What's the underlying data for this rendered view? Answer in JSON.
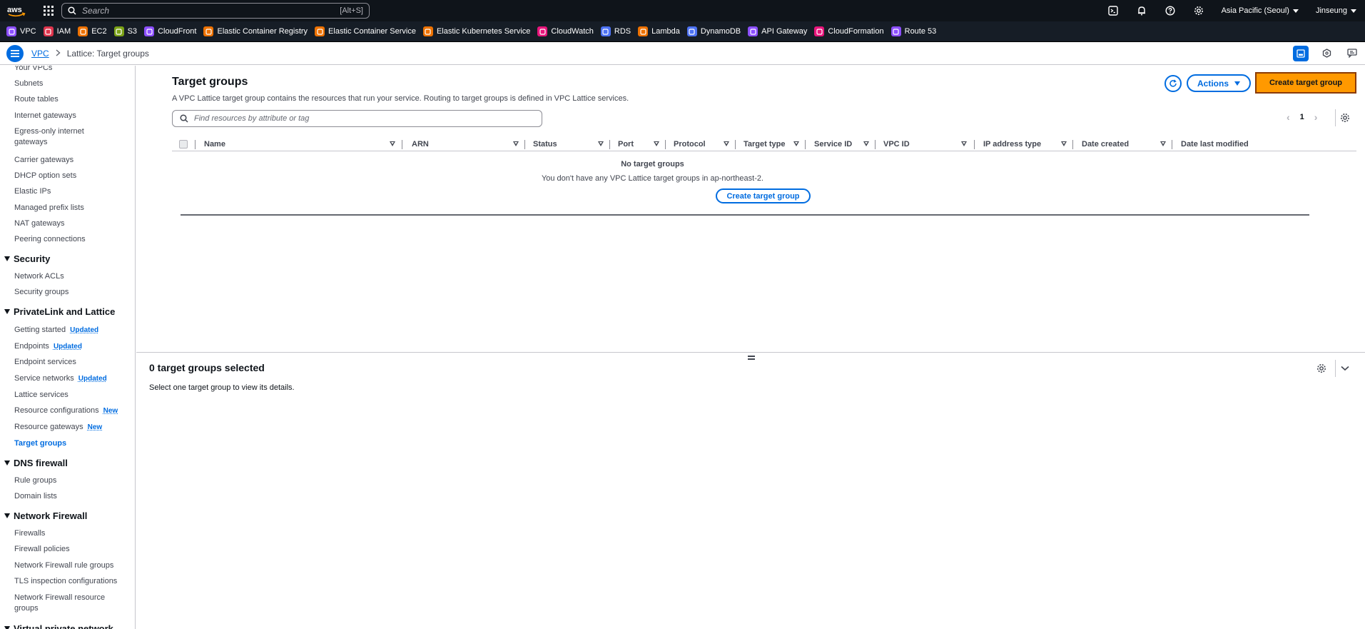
{
  "topbar": {
    "search_placeholder": "Search",
    "search_shortcut": "[Alt+S]",
    "region": "Asia Pacific (Seoul)",
    "user": "Jinseung"
  },
  "favorites": [
    {
      "label": "VPC",
      "color": "#8c4fff"
    },
    {
      "label": "IAM",
      "color": "#dd344c"
    },
    {
      "label": "EC2",
      "color": "#ed7100"
    },
    {
      "label": "S3",
      "color": "#7aa116"
    },
    {
      "label": "CloudFront",
      "color": "#8c4fff"
    },
    {
      "label": "Elastic Container Registry",
      "color": "#ed7100"
    },
    {
      "label": "Elastic Container Service",
      "color": "#ed7100"
    },
    {
      "label": "Elastic Kubernetes Service",
      "color": "#ed7100"
    },
    {
      "label": "CloudWatch",
      "color": "#e7157b"
    },
    {
      "label": "RDS",
      "color": "#4d72f3"
    },
    {
      "label": "Lambda",
      "color": "#ed7100"
    },
    {
      "label": "DynamoDB",
      "color": "#4d72f3"
    },
    {
      "label": "API Gateway",
      "color": "#8c4fff"
    },
    {
      "label": "CloudFormation",
      "color": "#e7157b"
    },
    {
      "label": "Route 53",
      "color": "#8c4fff"
    }
  ],
  "breadcrumb": {
    "root": "VPC",
    "current": "Lattice: Target groups"
  },
  "sidebar": {
    "items_top": [
      "Your VPCs",
      "Subnets",
      "Route tables",
      "Internet gateways",
      "Egress-only internet gateways",
      "Carrier gateways",
      "DHCP option sets",
      "Elastic IPs",
      "Managed prefix lists",
      "NAT gateways",
      "Peering connections"
    ],
    "security": {
      "title": "Security",
      "items": [
        "Network ACLs",
        "Security groups"
      ]
    },
    "privatelink": {
      "title": "PrivateLink and Lattice",
      "items": [
        {
          "label": "Getting started",
          "badge": "Updated"
        },
        {
          "label": "Endpoints",
          "badge": "Updated"
        },
        {
          "label": "Endpoint services",
          "badge": ""
        },
        {
          "label": "Service networks",
          "badge": "Updated"
        },
        {
          "label": "Lattice services",
          "badge": ""
        },
        {
          "label": "Resource configurations",
          "badge": "New"
        },
        {
          "label": "Resource gateways",
          "badge": "New"
        },
        {
          "label": "Target groups",
          "badge": ""
        }
      ]
    },
    "dns": {
      "title": "DNS firewall",
      "items": [
        "Rule groups",
        "Domain lists"
      ]
    },
    "firewall": {
      "title": "Network Firewall",
      "items": [
        "Firewalls",
        "Firewall policies",
        "Network Firewall rule groups",
        "TLS inspection configurations",
        "Network Firewall resource groups"
      ]
    },
    "vpn": {
      "title": "Virtual private network"
    }
  },
  "main": {
    "title": "Target groups",
    "description": "A VPC Lattice target group contains the resources that run your service. Routing to target groups is defined in VPC Lattice services.",
    "actions_label": "Actions",
    "create_label": "Create target group",
    "filter_placeholder": "Find resources by attribute or tag",
    "page_number": "1",
    "columns": [
      "Name",
      "ARN",
      "Status",
      "Port",
      "Protocol",
      "Target type",
      "Service ID",
      "VPC ID",
      "IP address type",
      "Date created",
      "Date last modified"
    ],
    "empty_title": "No target groups",
    "empty_desc": "You don't have any VPC Lattice target groups in ap-northeast-2.",
    "empty_button": "Create target group"
  },
  "split": {
    "title": "0 target groups selected",
    "description": "Select one target group to view its details."
  }
}
